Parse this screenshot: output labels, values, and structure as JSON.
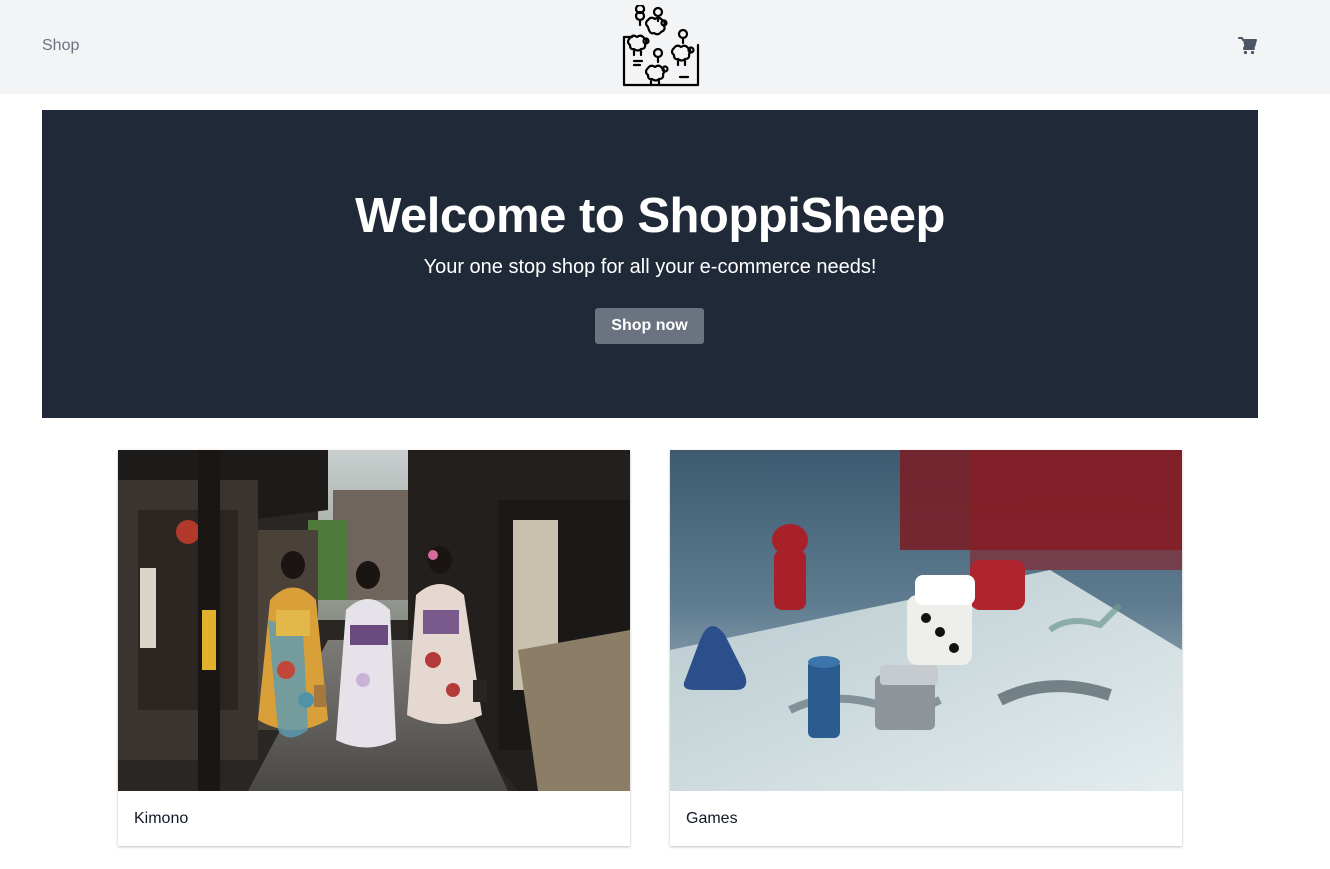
{
  "header": {
    "nav_link": "Shop",
    "logo_icon": "sheep-map-logo-icon",
    "cart_icon": "shopping-cart-icon"
  },
  "hero": {
    "title": "Welcome to ShoppiSheep",
    "subtitle": "Your one stop shop for all your e-commerce needs!",
    "button_label": "Shop now"
  },
  "categories": [
    {
      "label": "Kimono",
      "image": "kimono-street-photo"
    },
    {
      "label": "Games",
      "image": "board-game-dice-photo"
    }
  ],
  "colors": {
    "header_bg": "#f3f4f6",
    "hero_bg": "#1f2937",
    "button_bg": "#6b7280",
    "nav_text": "#6b7280"
  }
}
